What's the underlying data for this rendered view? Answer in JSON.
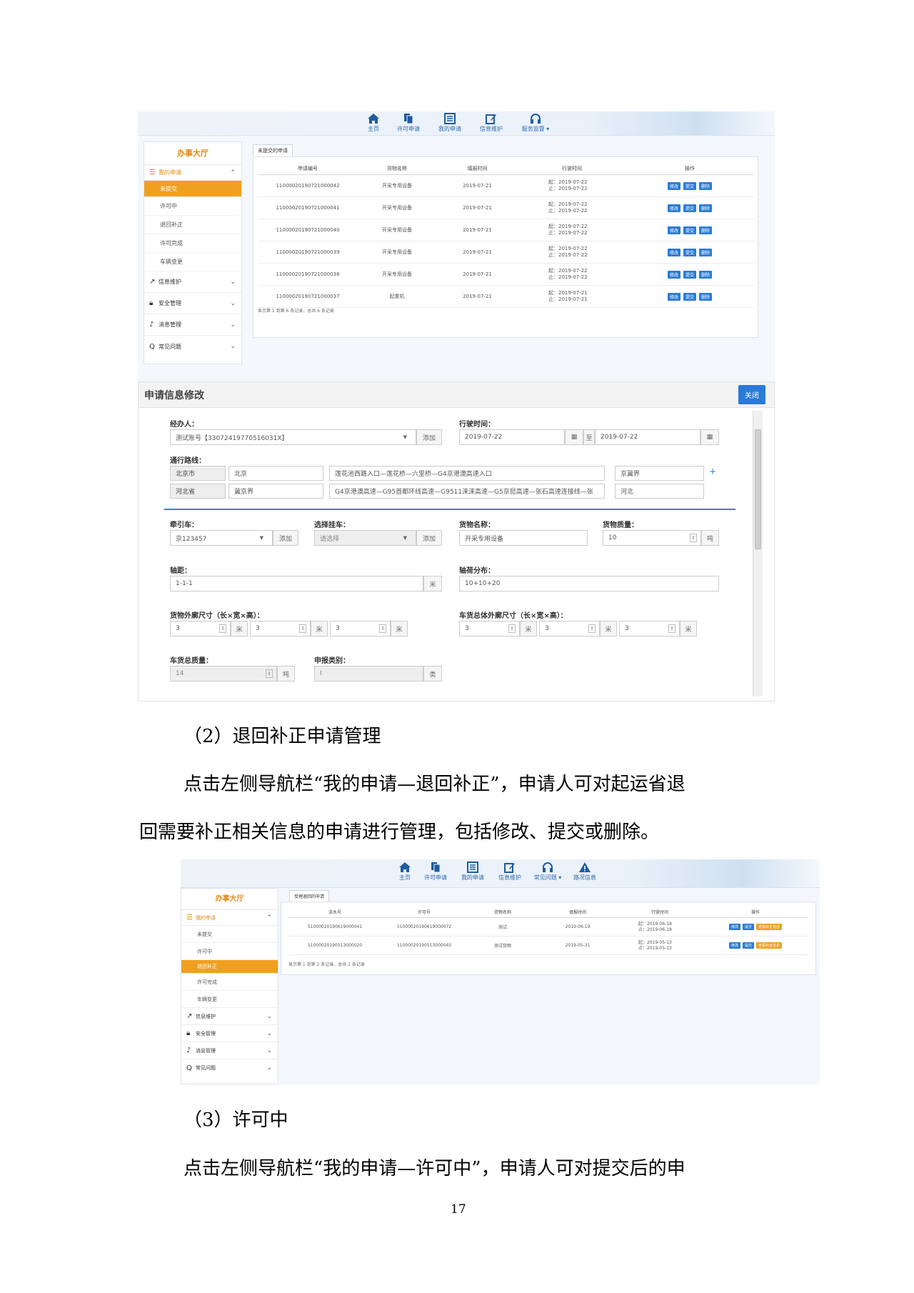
{
  "nav1": [
    {
      "label": "主页",
      "icon": "home-icon"
    },
    {
      "label": "许可申请",
      "icon": "files-icon"
    },
    {
      "label": "我的申请",
      "icon": "list-icon"
    },
    {
      "label": "信息维护",
      "icon": "edit-icon"
    },
    {
      "label": "服务监督 ▾",
      "icon": "headset-icon"
    }
  ],
  "sidebar1": {
    "title": "办事大厅",
    "group_main": "我的申请",
    "items": [
      "未提交",
      "许可中",
      "退回补正",
      "许可完成",
      "车辆变更"
    ],
    "groups": [
      "信息维护",
      "安全管理",
      "消息管理",
      "常见问题"
    ]
  },
  "tab1": "未提交的申请",
  "table1": {
    "headers": [
      "申请编号",
      "货物名称",
      "填报时间",
      "行驶时间",
      "操作"
    ],
    "rows": [
      {
        "id": "11000020190721000042",
        "goods": "开采专用设备",
        "date": "2019-07-21",
        "start": "起：2019-07-22",
        "end": "止：2019-07-22"
      },
      {
        "id": "11000020190721000041",
        "goods": "开采专用设备",
        "date": "2019-07-21",
        "start": "起：2019-07-22",
        "end": "止：2019-07-22"
      },
      {
        "id": "11000020190721000040",
        "goods": "开采专用设备",
        "date": "2019-07-21",
        "start": "起：2019-07-22",
        "end": "止：2019-07-22"
      },
      {
        "id": "11000020190721000039",
        "goods": "开采专用设备",
        "date": "2019-07-21",
        "start": "起：2019-07-22",
        "end": "止：2019-07-22"
      },
      {
        "id": "11000020190721000038",
        "goods": "开采专用设备",
        "date": "2019-07-21",
        "start": "起：2019-07-22",
        "end": "止：2019-07-22"
      },
      {
        "id": "11000020190721000037",
        "goods": "起重机",
        "date": "2019-07-21",
        "start": "起：2019-07-21",
        "end": "止：2019-07-21"
      }
    ],
    "buttons": [
      "修改",
      "提交",
      "删除"
    ],
    "pager": "显示第 1 到第 6 条记录，总共 6 条记录"
  },
  "modal": {
    "title": "申请信息修改",
    "close": "关闭",
    "agent_label": "经办人：",
    "agent_value": "测试账号【33072419770516031X】",
    "add": "添加",
    "time_label": "行驶时间：",
    "time_start": "2019-07-22",
    "to": "至",
    "time_end": "2019-07-22",
    "route_label": "通行路线：",
    "route1": {
      "prov": "北京市",
      "city": "北京",
      "path": "莲花池西路入口—莲花桥—六里桥—G4京港澳高速入口",
      "end": "京冀界"
    },
    "route2": {
      "prov": "河北省",
      "city": "冀京界",
      "path": "G4京港澳高速—G95首都环线高速—G9511涞涞高速—G5京昆高速—张石高速连接线—张",
      "end": "河北"
    },
    "tractor_label": "牵引车：",
    "tractor_value": "京123457",
    "trailer_label": "选择挂车：",
    "trailer_value": "请选择",
    "goods_label": "货物名称：",
    "goods_value": "开采专用设备",
    "weight_label": "货物质量：",
    "weight_value": "10",
    "ton": "吨",
    "axle_label": "轴距：",
    "axle_value": "1-1-1",
    "meter": "米",
    "load_label": "轴荷分布：",
    "load_value": "10+10+20",
    "goods_dim_label": "货物外廓尺寸（长×宽×高）：",
    "goods_dims": [
      "3",
      "3",
      "3"
    ],
    "veh_dim_label": "车货总体外廓尺寸（长×宽×高）：",
    "veh_dims": [
      "3",
      "3",
      "3"
    ],
    "total_label": "车货总质量：",
    "total_value": "14",
    "cat_label": "申报类别：",
    "cat_value": "I",
    "cat_unit": "类"
  },
  "text": {
    "h2": "（2）退回补正申请管理",
    "p1a": "点击左侧导航栏“我的申请—退回补正”，申请人可对起运省退",
    "p1b": "回需要补正相关信息的申请进行管理，包括修改、提交或删除。",
    "h3": "（3）许可中",
    "p2": "点击左侧导航栏“我的申请—许可中”，申请人可对提交后的申",
    "page": "17"
  },
  "nav2": [
    {
      "label": "主页",
      "icon": "home-icon"
    },
    {
      "label": "许可申请",
      "icon": "files-icon"
    },
    {
      "label": "我的申请",
      "icon": "list-icon"
    },
    {
      "label": "信息维护",
      "icon": "edit-icon"
    },
    {
      "label": "常见问题 ▾",
      "icon": "headset-icon"
    },
    {
      "label": "路况信息",
      "icon": "warning-icon"
    }
  ],
  "sidebar2": {
    "title": "办事大厅",
    "group_main": "我的申请",
    "items": [
      "未提交",
      "许可中",
      "退回补正",
      "许可完成",
      "车辆变更"
    ],
    "groups": [
      "信息维护",
      "安全管理",
      "消息管理",
      "常见问题"
    ]
  },
  "tab2": "受理退回的申请",
  "table2": {
    "headers": [
      "流水号",
      "许可号",
      "货物名称",
      "填报时间",
      "行驶时间",
      "操作"
    ],
    "rows": [
      {
        "id": "51000020190619000041",
        "permit": "51000020190619000072",
        "goods": "测试",
        "date": "2019-06-19",
        "start": "起：2019-06-18",
        "end": "止：2019-06-18"
      },
      {
        "id": "11000020190513000020",
        "permit": "11000020190513000045",
        "goods": "测试货物",
        "date": "2019-05-31",
        "start": "起：2019-05-13",
        "end": "止：2019-05-13"
      }
    ],
    "buttons": [
      "修改",
      "提交",
      "查看补正信息"
    ],
    "pager": "显示第 1 到第 2 条记录，总共 2 条记录"
  }
}
